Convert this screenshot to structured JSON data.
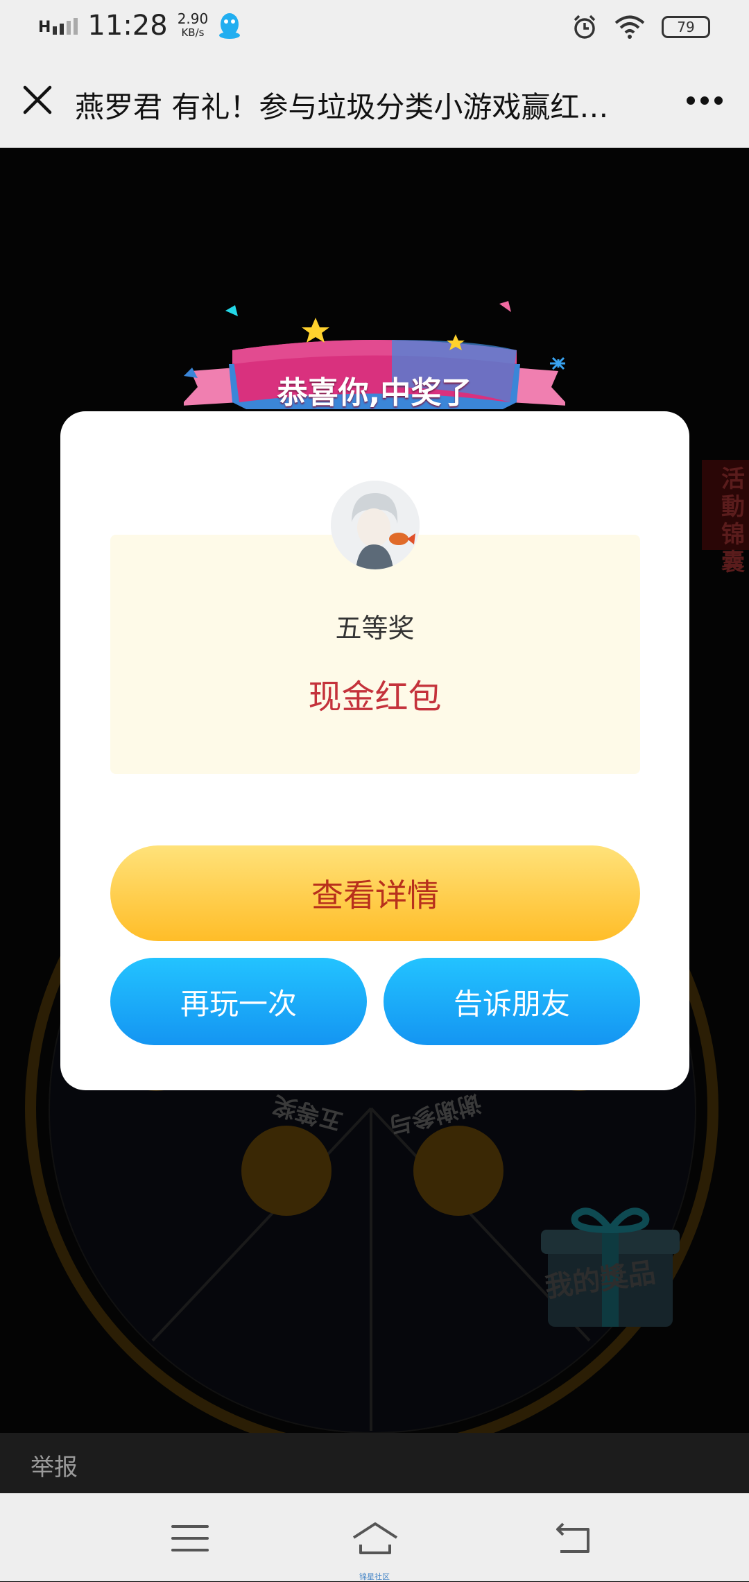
{
  "status_bar": {
    "network": "H",
    "time": "11:28",
    "speed_value": "2.90",
    "speed_unit": "KB/s",
    "battery": "79"
  },
  "title_bar": {
    "title": "燕罗君 有礼！参与垃圾分类小游戏赢红…"
  },
  "game": {
    "segment_labels": [
      "五等奖",
      "谢谢参与"
    ],
    "side_tab_label": "活動锦囊",
    "my_prizes_label": "我的獎品"
  },
  "modal": {
    "ribbon_text": "恭喜你,中奖了",
    "prize_level": "五等奖",
    "prize_name": "现金红包",
    "detail_button": "查看详情",
    "play_again_button": "再玩一次",
    "tell_friends_button": "告诉朋友"
  },
  "report_bar": {
    "label": "举报"
  },
  "nav_bar": {
    "caption": "锦星社区"
  },
  "colors": {
    "prize_red": "#c4323b",
    "gold_button": "#ffbd28",
    "blue_button": "#1495f2",
    "panel_cream": "#fefae8"
  }
}
